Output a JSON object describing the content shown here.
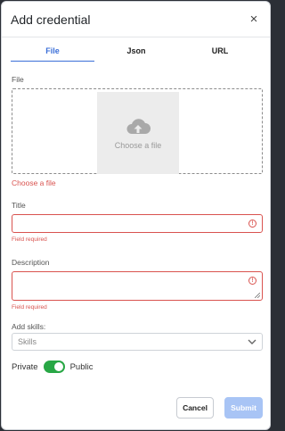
{
  "modal": {
    "title": "Add credential",
    "close_glyph": "×"
  },
  "tabs": [
    {
      "label": "File",
      "active": true
    },
    {
      "label": "Json",
      "active": false
    },
    {
      "label": "URL",
      "active": false
    }
  ],
  "file": {
    "label": "File",
    "dropzone_text": "Choose a file",
    "error_link": "Choose a file"
  },
  "title_field": {
    "label": "Title",
    "value": "",
    "error": "Field required"
  },
  "description_field": {
    "label": "Description",
    "value": "",
    "error": "Field required"
  },
  "skills": {
    "label": "Add skills:",
    "placeholder": "Skills"
  },
  "visibility": {
    "left_label": "Private",
    "right_label": "Public",
    "is_public": true
  },
  "actions": {
    "cancel": "Cancel",
    "submit": "Submit"
  },
  "colors": {
    "accent": "#3b6fd8",
    "error": "#d9534f",
    "toggle_on": "#28a745",
    "submit_disabled": "#a8c4f5"
  }
}
